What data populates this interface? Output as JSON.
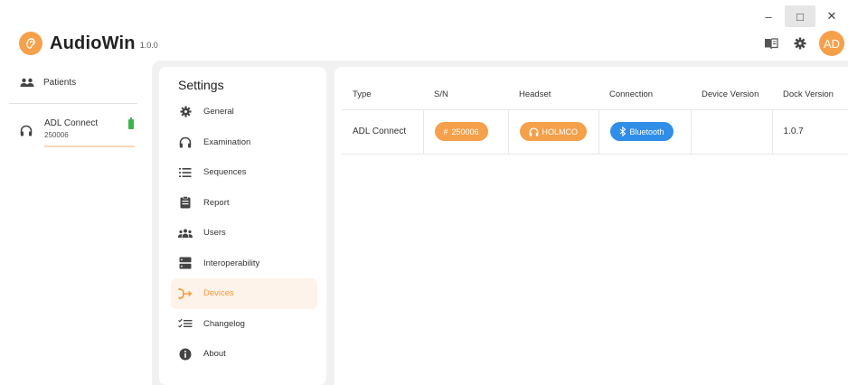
{
  "window": {
    "minimize": "–",
    "maximize": "□",
    "close": "✕"
  },
  "app": {
    "name": "AudioWin",
    "version": "1.0.0"
  },
  "header": {
    "avatar_initials": "AD",
    "icons": [
      "book-icon",
      "gear-icon"
    ]
  },
  "left_nav": {
    "patients_label": "Patients",
    "device": {
      "name": "ADL Connect",
      "serial": "250006"
    }
  },
  "settings": {
    "title": "Settings",
    "items": [
      {
        "label": "General",
        "icon": "gear-icon"
      },
      {
        "label": "Examination",
        "icon": "headphones-icon"
      },
      {
        "label": "Sequences",
        "icon": "list-icon"
      },
      {
        "label": "Report",
        "icon": "clipboard-icon"
      },
      {
        "label": "Users",
        "icon": "users-icon"
      },
      {
        "label": "Interoperability",
        "icon": "server-icon"
      },
      {
        "label": "Devices",
        "icon": "devices-icon",
        "active": true
      },
      {
        "label": "Changelog",
        "icon": "checklist-icon"
      },
      {
        "label": "About",
        "icon": "info-icon"
      }
    ]
  },
  "devices_table": {
    "columns": [
      "Type",
      "S/N",
      "Headset",
      "Connection",
      "Device Version",
      "Dock Version"
    ],
    "rows": [
      {
        "type": "ADL Connect",
        "sn": "250006",
        "headset": "HOLMCO",
        "connection": "Bluetooth",
        "device_version": "",
        "dock_version": "1.0.7"
      }
    ]
  },
  "colors": {
    "accent": "#f5a04a",
    "bluetooth": "#2f8fe8",
    "battery": "#3bb54a"
  }
}
